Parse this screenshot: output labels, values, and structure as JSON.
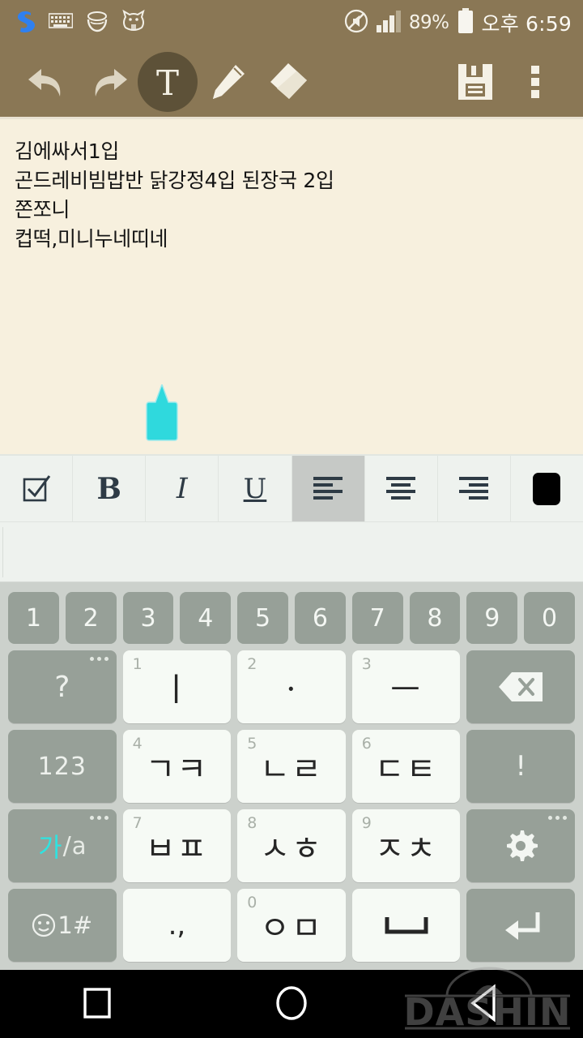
{
  "status_bar": {
    "background": "#8a7755",
    "left_icons": [
      {
        "name": "samsung-s-app-icon",
        "label": "S"
      },
      {
        "name": "keyboard-icon",
        "label": "keyboard"
      },
      {
        "name": "bowl-app-icon",
        "label": "bowl"
      },
      {
        "name": "cat-restaurant-app-icon",
        "label": "cat"
      }
    ],
    "mute_icon": "mute-icon",
    "signal_icon": "signal-bars-icon",
    "battery_percent": "89%",
    "battery_icon": "battery-icon",
    "clock": "오후 6:59"
  },
  "app_toolbar": {
    "background": "#8a7755",
    "selected_color": "#5d5138",
    "buttons": [
      {
        "name": "undo-button",
        "label": "Undo",
        "selected": false
      },
      {
        "name": "redo-button",
        "label": "Redo",
        "selected": false
      },
      {
        "name": "text-tool-button",
        "label": "T",
        "selected": true
      },
      {
        "name": "pen-tool-button",
        "label": "Pen",
        "selected": false
      },
      {
        "name": "eraser-tool-button",
        "label": "Eraser",
        "selected": false
      },
      {
        "name": "save-button",
        "label": "Save",
        "selected": false
      },
      {
        "name": "overflow-menu-button",
        "label": "More",
        "selected": false
      }
    ]
  },
  "note": {
    "background": "#f7f0de",
    "lines": [
      "김에싸서1입",
      "곤드레비빔밥반 닭강정4입 된장국 2입",
      "쫀쪼니",
      "컵떡,미니누네띠네"
    ],
    "cursor_handle_color": "#2fd9dd"
  },
  "format_bar": {
    "background": "#eef2ee",
    "active_background": "#c6c9c6",
    "buttons": [
      {
        "name": "checkbox-button",
        "label": "checkbox",
        "active": false
      },
      {
        "name": "bold-button",
        "label": "B",
        "active": false
      },
      {
        "name": "italic-button",
        "label": "I",
        "active": false
      },
      {
        "name": "underline-button",
        "label": "U",
        "active": false
      },
      {
        "name": "align-left-button",
        "label": "align left",
        "active": true
      },
      {
        "name": "align-center-button",
        "label": "align center",
        "active": false
      },
      {
        "name": "align-right-button",
        "label": "align right",
        "active": false
      },
      {
        "name": "text-color-swatch",
        "label": "color",
        "active": false,
        "color": "#000000"
      }
    ]
  },
  "suggestion_bar": {
    "text": ""
  },
  "keyboard": {
    "background": "#ccd1cc",
    "white_key": "#f6faf5",
    "gray_key": "#97a098",
    "number_row": [
      "1",
      "2",
      "3",
      "4",
      "5",
      "6",
      "7",
      "8",
      "9",
      "0"
    ],
    "rows": [
      [
        {
          "name": "key-question",
          "label": "?",
          "type": "gray",
          "sup": "",
          "dots": true
        },
        {
          "name": "key-vowel-i",
          "label": "ㅣ",
          "type": "white",
          "sup": "1",
          "dots": false
        },
        {
          "name": "key-vowel-dot",
          "label": "ㆍ",
          "type": "white",
          "sup": "2",
          "dots": false
        },
        {
          "name": "key-vowel-eu",
          "label": "ㅡ",
          "type": "white",
          "sup": "3",
          "dots": false
        },
        {
          "name": "key-backspace",
          "label": "backspace",
          "type": "gray",
          "sup": "",
          "dots": false
        }
      ],
      [
        {
          "name": "key-123",
          "label": "123",
          "type": "gray",
          "sup": "",
          "dots": false
        },
        {
          "name": "key-giyeok-kieuk",
          "label": "ㄱㅋ",
          "type": "white",
          "sup": "4",
          "dots": false
        },
        {
          "name": "key-nieun-rieul",
          "label": "ㄴㄹ",
          "type": "white",
          "sup": "5",
          "dots": false
        },
        {
          "name": "key-digeut-tieut",
          "label": "ㄷㅌ",
          "type": "white",
          "sup": "6",
          "dots": false
        },
        {
          "name": "key-exclamation",
          "label": "!",
          "type": "gray",
          "sup": "",
          "dots": false
        }
      ],
      [
        {
          "name": "key-language-toggle",
          "label_ko": "가",
          "label_sep": "/",
          "label_en": "a",
          "type": "gray",
          "sup": "",
          "dots": true
        },
        {
          "name": "key-bieup-pieup",
          "label": "ㅂㅍ",
          "type": "white",
          "sup": "7",
          "dots": false
        },
        {
          "name": "key-siot-hieut",
          "label": "ㅅㅎ",
          "type": "white",
          "sup": "8",
          "dots": false
        },
        {
          "name": "key-jieut-chieut",
          "label": "ㅈㅊ",
          "type": "white",
          "sup": "9",
          "dots": false
        },
        {
          "name": "key-settings",
          "label": "settings",
          "type": "gray",
          "sup": "",
          "dots": true
        }
      ],
      [
        {
          "name": "key-emoji-symbols",
          "label": "1#",
          "type": "gray",
          "sup": "",
          "dots": false
        },
        {
          "name": "key-punctuation",
          "label": ".,",
          "type": "white",
          "sup": "",
          "dots": false
        },
        {
          "name": "key-ieung-mieum",
          "label": "ㅇㅁ",
          "type": "white",
          "sup": "0",
          "dots": false
        },
        {
          "name": "key-space",
          "label": "space",
          "type": "white",
          "sup": "",
          "dots": false
        },
        {
          "name": "key-enter",
          "label": "enter",
          "type": "gray",
          "sup": "",
          "dots": false
        }
      ]
    ]
  },
  "nav_bar": {
    "background": "#000000",
    "buttons": [
      {
        "name": "nav-recents-button",
        "label": "recents"
      },
      {
        "name": "nav-home-button",
        "label": "home"
      },
      {
        "name": "nav-back-button",
        "label": "back"
      }
    ],
    "watermark": "DASHIN"
  }
}
